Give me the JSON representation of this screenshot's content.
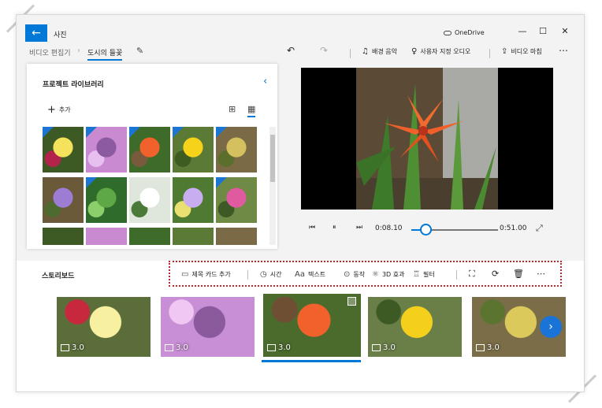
{
  "app": {
    "title": "사진",
    "back_glyph": "←",
    "cloud_label": "OneDrive"
  },
  "window": {
    "minimize": "—",
    "maximize": "☐",
    "close": "✕"
  },
  "breadcrumb": {
    "parent": "비디오 편집기",
    "separator": "›",
    "current": "도시의 들꽃",
    "edit_glyph": "✎"
  },
  "toolbar": {
    "undo": "↶",
    "redo": "↷",
    "music_icon": "♫",
    "music_label": "배경 음악",
    "audio_icon": "♀",
    "audio_label": "사용자 지정 오디오",
    "finish_icon": "⇪",
    "finish_label": "비디오 마침",
    "more": "⋯"
  },
  "library": {
    "title": "프로젝트 라이브러리",
    "collapse_glyph": "‹",
    "add_glyph": "+",
    "add_label": "추가",
    "view_large": "⊞",
    "view_small": "▦",
    "thumbnails": [
      {
        "colors": [
          "#3d5a24",
          "#f5e25c",
          "#b3244a"
        ],
        "in_project": true
      },
      {
        "colors": [
          "#c98ad2",
          "#8b5aa0",
          "#e8c0ef"
        ],
        "in_project": true
      },
      {
        "colors": [
          "#3f6b2a",
          "#f0612b",
          "#7a5a3c"
        ],
        "in_project": true
      },
      {
        "colors": [
          "#5a7a35",
          "#f6d31a",
          "#3d5c22"
        ],
        "in_project": true
      },
      {
        "colors": [
          "#7a6a45",
          "#d5c060",
          "#5b6e2c"
        ],
        "in_project": true
      },
      {
        "colors": [
          "#6a5a3a",
          "#9d7cd4",
          "#4e6a2e"
        ],
        "in_project": false
      },
      {
        "colors": [
          "#2f6b2a",
          "#5fa848",
          "#8ccf6a"
        ],
        "in_project": true
      },
      {
        "colors": [
          "#dfe6dc",
          "#ffffff",
          "#4a7a3a"
        ],
        "in_project": false
      },
      {
        "colors": [
          "#4e7a32",
          "#c8aef0",
          "#e8e070"
        ],
        "in_project": false
      },
      {
        "colors": [
          "#6e8a45",
          "#e05aa0",
          "#3d5a26"
        ],
        "in_project": true
      }
    ]
  },
  "player": {
    "skip_back": "⏮",
    "pause": "⏸",
    "skip_forward": "⏭",
    "current_time": "0:08.10",
    "total_time": "0:51.00",
    "fullscreen": "⤢",
    "progress_fraction": 0.16
  },
  "storyboard": {
    "title": "스토리보드",
    "tools": [
      {
        "icon": "▭",
        "label": "제목 카드 추가"
      },
      {
        "icon": "◷",
        "label": "시간"
      },
      {
        "icon": "Aa",
        "label": "텍스트"
      },
      {
        "icon": "⊙",
        "label": "동작"
      },
      {
        "icon": "⚛",
        "label": "3D 효과"
      },
      {
        "icon": "♖",
        "label": "필터"
      }
    ],
    "crop_glyph": "⛶",
    "rotate_glyph": "⟳",
    "delete_glyph": "🗑",
    "more_glyph": "⋯",
    "next_glyph": "›",
    "clips": [
      {
        "duration": "3.0",
        "colors": [
          "#5b6e3a",
          "#f7f0a0",
          "#c8283e"
        ],
        "selected": false
      },
      {
        "duration": "3.0",
        "colors": [
          "#c88fd6",
          "#8a5a9c",
          "#f0c7f3"
        ],
        "selected": false
      },
      {
        "duration": "3.0",
        "colors": [
          "#4a6b2c",
          "#f1612c",
          "#6e4f34"
        ],
        "selected": true
      },
      {
        "duration": "3.0",
        "colors": [
          "#6a7e48",
          "#f4d01c",
          "#3e5a24"
        ],
        "selected": false
      },
      {
        "duration": "3.0",
        "colors": [
          "#7a6d48",
          "#dcc95b",
          "#5b7430"
        ],
        "selected": false
      }
    ]
  }
}
